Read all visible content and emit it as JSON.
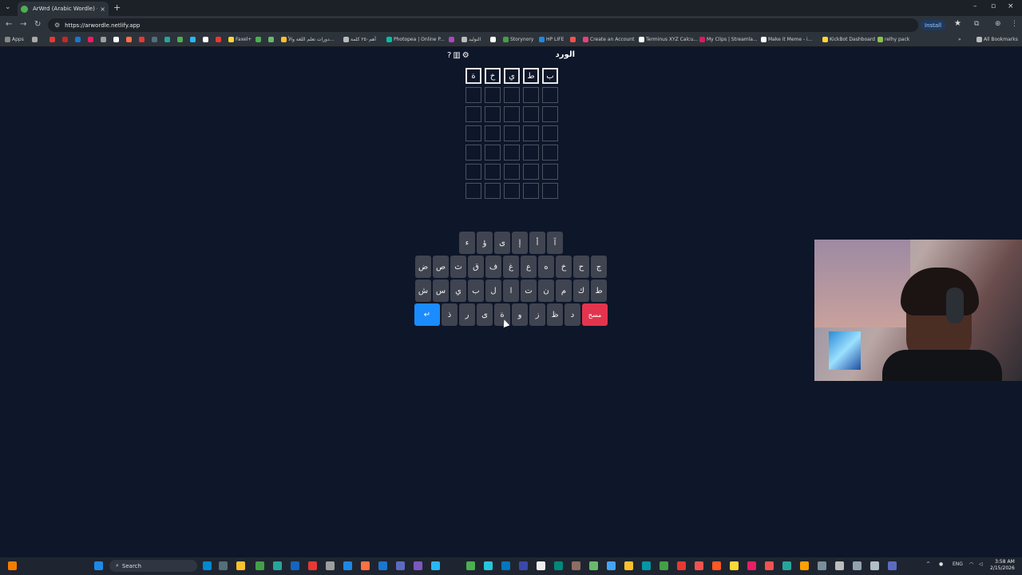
{
  "browser": {
    "tab_title": "ArWrd (Arabic Wordle) - الورد",
    "url": "https://arwordle.netlify.app",
    "install_label": "Install",
    "bookmarks": [
      {
        "label": "Apps"
      },
      {
        "label": "Faxel+"
      },
      {
        "label": "دورات تعلم اللغة والأ..."
      },
      {
        "label": "أهم٢٥٠ كلمة"
      },
      {
        "label": "Photopea | Online P..."
      },
      {
        "label": "التوليد"
      },
      {
        "label": "Storynory"
      },
      {
        "label": "HP LIFE"
      },
      {
        "label": "Create an Account"
      },
      {
        "label": "Terminus XYZ Calcu..."
      },
      {
        "label": "My Clips | Streamla..."
      },
      {
        "label": "Make it Meme - i..."
      },
      {
        "label": "KickBot Dashboard"
      },
      {
        "label": "relhy pack"
      },
      {
        "label": "All Bookmarks"
      }
    ]
  },
  "game": {
    "title": "الورد",
    "help_icon": "?",
    "stats_icon": "stats-icon",
    "settings_icon": "gear-icon",
    "rows": [
      [
        "ب",
        "ط",
        "ي",
        "خ",
        "ة"
      ],
      [
        "",
        "",
        "",
        "",
        ""
      ],
      [
        "",
        "",
        "",
        "",
        ""
      ],
      [
        "",
        "",
        "",
        "",
        ""
      ],
      [
        "",
        "",
        "",
        "",
        ""
      ],
      [
        "",
        "",
        "",
        "",
        ""
      ],
      [
        "",
        "",
        "",
        "",
        ""
      ]
    ],
    "keyboard": {
      "row1": [
        "آ",
        "أ",
        "إ",
        "ى",
        "ؤ",
        "ء"
      ],
      "row2": [
        "ج",
        "ح",
        "خ",
        "ه",
        "ع",
        "غ",
        "ف",
        "ق",
        "ث",
        "ص",
        "ض"
      ],
      "row3": [
        "ط",
        "ك",
        "م",
        "ن",
        "ت",
        "ا",
        "ل",
        "ب",
        "ي",
        "س",
        "ش"
      ],
      "row4": [
        "مسح",
        "د",
        "ظ",
        "ز",
        "و",
        "ة",
        "ى",
        "ر",
        "ذ",
        "↵"
      ]
    }
  },
  "taskbar": {
    "search_placeholder": "Search",
    "lang": "ENG",
    "time": "3:58 AM",
    "date": "2/15/2026"
  }
}
